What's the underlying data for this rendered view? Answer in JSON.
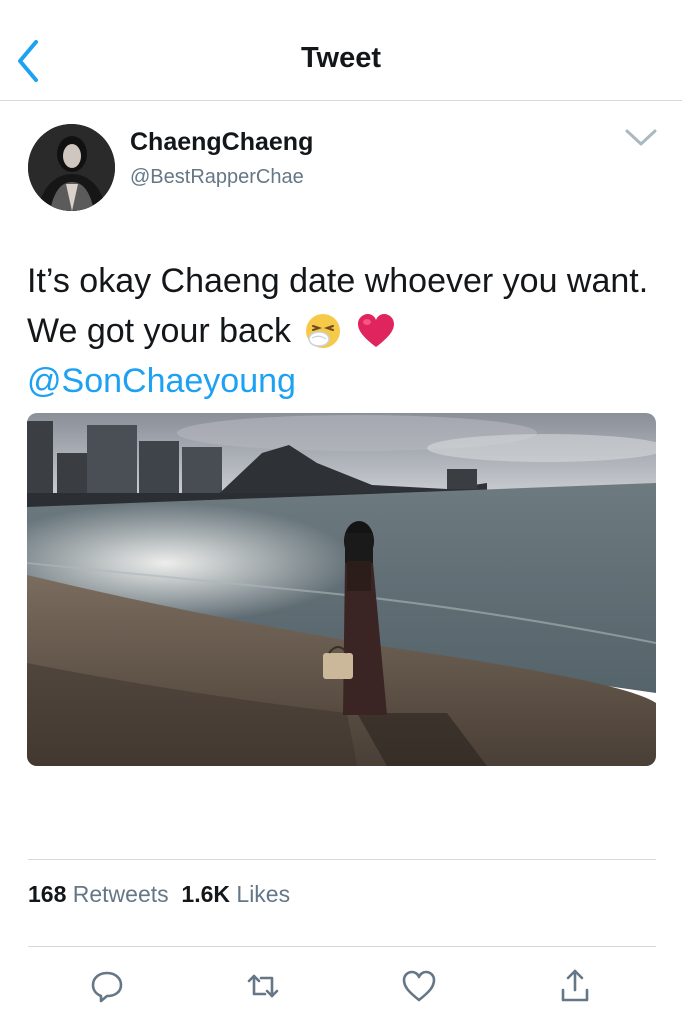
{
  "header": {
    "title": "Tweet",
    "back_icon": "chevron-left-icon"
  },
  "tweet": {
    "display_name": "ChaengChaeng",
    "handle": "@BestRapperChae",
    "text": "It’s okay Chaeng date whoever you want. We got your back",
    "emojis": [
      "sneezing-face-emoji",
      "red-heart-emoji"
    ],
    "mention": "@SonChaeyoung"
  },
  "stats": {
    "retweets_count": "168",
    "retweets_label": "Retweets",
    "likes_count": "1.6K",
    "likes_label": "Likes"
  },
  "actions": [
    "reply-icon",
    "retweet-icon",
    "like-icon",
    "share-icon"
  ],
  "colors": {
    "accent": "#1da1f2",
    "text": "#14171a",
    "secondary": "#657786",
    "divider": "#d6d9dc"
  }
}
